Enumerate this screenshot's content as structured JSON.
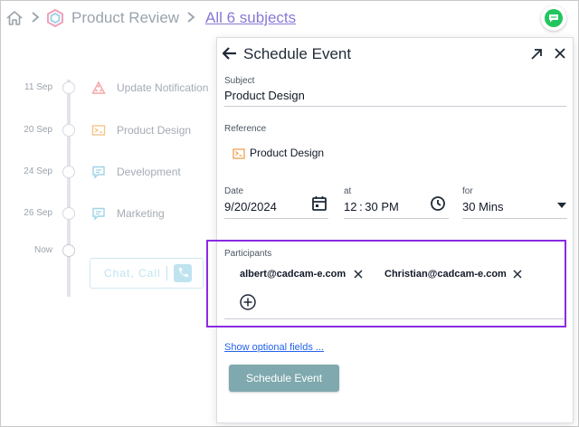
{
  "breadcrumb": {
    "product": "Product Review",
    "all_subjects": "All 6 subjects"
  },
  "timeline": {
    "items": [
      {
        "date": "11 Sep",
        "label": "Update Notification",
        "icon": "alert-triangle-icon",
        "color": "#f4a6a6"
      },
      {
        "date": "20 Sep",
        "label": "Product Design",
        "icon": "design-card-icon",
        "color": "#f6c38a"
      },
      {
        "date": "24 Sep",
        "label": "Development",
        "icon": "chat-bubble-icon",
        "color": "#9fd3e8"
      },
      {
        "date": "26 Sep",
        "label": "Marketing",
        "icon": "chat-bubble-icon",
        "color": "#9fd3e8"
      },
      {
        "date": "Now",
        "label": "",
        "icon": "",
        "color": ""
      }
    ],
    "chat_call_label": "Chat, Call"
  },
  "panel": {
    "title": "Schedule Event",
    "subject_label": "Subject",
    "subject_value": "Product Design",
    "reference_label": "Reference",
    "reference_value": "Product Design",
    "date_label": "Date",
    "date_value": "9/20/2024",
    "at_label": "at",
    "time_value": "12 : 30 PM",
    "for_label": "for",
    "duration_value": "30 Mins",
    "participants_label": "Participants",
    "participants": [
      "albert@cadcam-e.com",
      "Christian@cadcam-e.com"
    ],
    "optional_link": "Show optional fields ...",
    "schedule_button": "Schedule Event"
  },
  "colors": {
    "accent_purple": "#8a2be2",
    "button_teal": "#7fa9ae",
    "link_blue": "#2563eb",
    "chat_green": "#22c55e"
  }
}
